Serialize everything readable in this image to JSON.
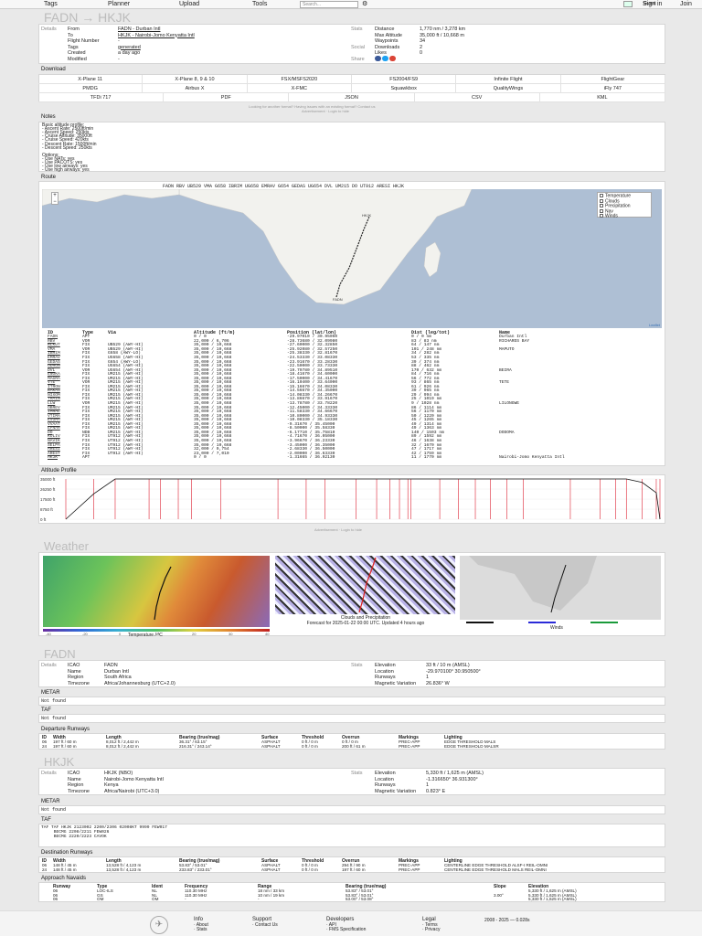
{
  "topnav": {
    "tags": "Tags",
    "planner": "Planner",
    "upload": "Upload",
    "tools": "Tools",
    "search_placeholder": "Search...",
    "guest": "Guest",
    "signin": "Sign in",
    "join": "Join"
  },
  "title": "FADN → HKJK",
  "details": {
    "section": "Details",
    "rows": [
      {
        "k": "From",
        "v": "FADN - Durban Intl"
      },
      {
        "k": "To",
        "v": "HKJK - Nairobi-Jomo Kenyatta Intl"
      },
      {
        "k": "Flight Number",
        "v": "-"
      },
      {
        "k": "Tags",
        "v": "generated"
      },
      {
        "k": "Created",
        "v": "a day ago"
      },
      {
        "k": "Modified",
        "v": "-"
      }
    ],
    "stats_label": "Stats",
    "stats": [
      {
        "k": "Distance",
        "v": "1,770 nm / 3,278 km"
      },
      {
        "k": "Max Altitude",
        "v": "35,000 ft / 10,668 m"
      },
      {
        "k": "Waypoints",
        "v": "34"
      }
    ],
    "social_label": "Social",
    "social": [
      {
        "k": "Downloads",
        "v": "2"
      },
      {
        "k": "Likes",
        "v": "0"
      }
    ],
    "share_label": "Share"
  },
  "download": {
    "section": "Download",
    "rows": [
      [
        "X-Plane 11",
        "X-Plane 8, 9 & 10",
        "FSX/MSFS2020",
        "FS2004/FS9",
        "Infinite Flight",
        "FlightGear"
      ],
      [
        "PMDG",
        "Airbus X",
        "X-FMC",
        "Squawkbox",
        "QualityWings",
        "iFly 747"
      ],
      [
        "TFDi 717",
        "PDF",
        "JSON",
        "CSV",
        "KML"
      ]
    ],
    "note": "Looking for another format? Having issues with an existing format? Contact us",
    "ads": "Advertisement · Login to hide"
  },
  "notes": {
    "section": "Notes",
    "lines": [
      "Basic altitude profile:",
      "- Ascent Rate: 2500ft/min",
      "- Ascent Speed: 250kts",
      "- Cruise Altitude: 35000ft",
      "- Cruise Speed: 420kts",
      "- Descent Rate: 1500ft/min",
      "- Descent Speed: 250kts",
      "",
      "Options:",
      "- Use NATs: yes",
      "- Use PACOTS: yes",
      "- Use low airways: yes",
      "- Use high airways: yes"
    ]
  },
  "route": {
    "section": "Route",
    "string": "FADN RBV UB529 VMA G658 IBRIM UG658 EMRAV G654 GEDAS UG654 DVL UM215 DO UT912 ARESI HKJK",
    "layers": [
      "Temperature",
      "Clouds",
      "Precipitation",
      "Nav",
      "Winds"
    ],
    "attribution": "Leaflet",
    "columns": [
      "ID",
      "Type",
      "Via",
      "Altitude (ft/m)",
      "Position (lat/lon)",
      "Dist (leg/tot)",
      "Name"
    ],
    "rows": [
      [
        "FADN",
        "APT",
        "",
        "0 / 0",
        "-29.97010 / 30.95050",
        "0 / 0 nm",
        "Durban Intl"
      ],
      [
        "RBV",
        "VOR",
        "",
        "22,000 / 6,706",
        "-28.73680 / 32.09980",
        "83 / 83 nm",
        "RICHARDS BAY"
      ],
      [
        "BLKUT",
        "FIX",
        "UB529 (AWY-HI)",
        "35,000 / 10,668",
        "-27.60000 / 32.32850",
        "64 / 147 nm",
        ""
      ],
      [
        "VMA",
        "VOR",
        "UB529 (AWY-HI)",
        "35,000 / 10,668",
        "-25.92080 / 32.57250",
        "101 / 248 nm",
        "MAPUTO"
      ],
      [
        "IBRIM",
        "FIX",
        "G658 (AWY-LO)",
        "35,000 / 10,668",
        "-25.38330 / 32.81670",
        "34 / 282 nm",
        ""
      ],
      [
        "EMRAV",
        "FIX",
        "UG658 (AWY-HI)",
        "35,000 / 10,668",
        "-24.53330 / 33.08330",
        "53 / 335 nm",
        ""
      ],
      [
        "GEDAS",
        "FIX",
        "G654 (AWY-LO)",
        "35,000 / 10,668",
        "-23.91670 / 33.28330",
        "39 / 374 nm",
        ""
      ],
      [
        "ODRUN",
        "FIX",
        "UG654 (AWY-HI)",
        "35,000 / 10,668",
        "-22.50000 / 33.73330",
        "88 / 462 nm",
        ""
      ],
      [
        "DVL",
        "VOR",
        "UG654 (AWY-HI)",
        "35,000 / 10,668",
        "-19.79780 / 34.89510",
        "170 / 632 nm",
        "BEIRA"
      ],
      [
        "ENOKA",
        "FIX",
        "UM215 (AWY-HI)",
        "35,000 / 10,668",
        "-18.41670 / 34.60000",
        "84 / 716 nm",
        ""
      ],
      [
        "MAGRA",
        "FIX",
        "UM215 (AWY-HI)",
        "35,000 / 10,668",
        "-17.50000 / 34.41670",
        "56 / 772 nm",
        ""
      ],
      [
        "VTE",
        "VOR",
        "UM215 (AWY-HI)",
        "35,000 / 10,668",
        "-16.10400 / 33.64000",
        "93 / 865 nm",
        "TETE"
      ],
      [
        "ITRON",
        "FIX",
        "UM215 (AWY-HI)",
        "35,000 / 10,668",
        "-15.16670 / 34.08330",
        "61 / 926 nm",
        ""
      ],
      [
        "BAKAS",
        "FIX",
        "UM215 (AWY-HI)",
        "35,000 / 10,668",
        "-14.56670 / 34.35000",
        "39 / 965 nm",
        ""
      ],
      [
        "NIXOM",
        "FIX",
        "UM215 (AWY-HI)",
        "35,000 / 10,668",
        "-14.08330 / 34.26670",
        "29 / 994 nm",
        ""
      ],
      [
        "THAIN",
        "FIX",
        "UM215 (AWY-HI)",
        "35,000 / 10,668",
        "-13.86670 / 33.91670",
        "25 / 1019 nm",
        ""
      ],
      [
        "LLW",
        "VOR",
        "UM215 (AWY-HI)",
        "35,000 / 10,668",
        "-13.78780 / 33.78220",
        "9 / 1028 nm",
        "LILONGWE"
      ],
      [
        "OBREV",
        "FIX",
        "UM215 (AWY-HI)",
        "35,000 / 10,668",
        "-12.45000 / 34.33330",
        "86 / 1114 nm",
        ""
      ],
      [
        "IMRAL",
        "FIX",
        "UM215 (AWY-HI)",
        "35,000 / 10,668",
        "-11.58330 / 34.66670",
        "56 / 1170 nm",
        ""
      ],
      [
        "VTIMA",
        "FIX",
        "UM215 (AWY-HI)",
        "35,000 / 10,668",
        "-10.80000 / 34.93330",
        "50 / 1220 nm",
        ""
      ],
      [
        "EVOMA",
        "FIX",
        "UM215 (AWY-HI)",
        "35,000 / 10,668",
        "-10.08330 / 35.18330",
        "45 / 1265 nm",
        ""
      ],
      [
        "VVAAT",
        "FIX",
        "UM215 (AWY-HI)",
        "35,000 / 10,668",
        "-9.31670 / 35.45000",
        "49 / 1314 nm",
        ""
      ],
      [
        "EPNAR",
        "FIX",
        "UM215 (AWY-HI)",
        "35,000 / 10,668",
        "-8.50000 / 35.58330",
        "49 / 1363 nm",
        ""
      ],
      [
        "DO",
        "NDB",
        "UM215 (AWY-HI)",
        "35,000 / 10,668",
        "-6.17710 / 35.75810",
        "140 / 1503 nm",
        "DODOMA"
      ],
      [
        "KOLIV",
        "FIX",
        "UT912 (AWY-HI)",
        "35,000 / 10,668",
        "-4.71670 / 36.05000",
        "89 / 1592 nm",
        ""
      ],
      [
        "NAVIK",
        "FIX",
        "UT912 (AWY-HI)",
        "35,000 / 10,668",
        "-3.96670 / 36.23330",
        "46 / 1638 nm",
        ""
      ],
      [
        "SELPA",
        "FIX",
        "UT912 (AWY-HI)",
        "35,000 / 10,668",
        "-3.45000 / 36.35000",
        "32 / 1670 nm",
        ""
      ],
      [
        "ARESI",
        "FIX",
        "UT912 (AWY-HI)",
        "32,000 / 9,754",
        "-2.68330 / 36.50000",
        "47 / 1717 nm",
        ""
      ],
      [
        "AREST",
        "FIX",
        "UT912 (AWY-HI)",
        "23,000 / 7,010",
        "-2.00000 / 36.63330",
        "42 / 1759 nm",
        ""
      ],
      [
        "HKJK",
        "APT",
        "",
        "0 / 0",
        "-1.31665 / 36.92130",
        "11 / 1770 nm",
        "Nairobi-Jomo Kenyatta Intl"
      ]
    ]
  },
  "altitude": {
    "section": "Altitude Profile",
    "ylabels": [
      "35000 ft",
      "26250 ft",
      "17500 ft",
      "8750 ft",
      "0 ft"
    ],
    "ads": "Advertisement · Login to hide"
  },
  "weather": {
    "title": "Weather",
    "temp_caption": "Temperature / °C",
    "temp_ticks": [
      "-40",
      "-20",
      "0",
      "10",
      "20",
      "30",
      "40"
    ],
    "cloud_caption": "Clouds and Precipitation\nForecast for 2025-01-22 00:00 UTC. Updated 4 hours ago",
    "wind_caption": "Winds"
  },
  "fadn": {
    "title": "FADN",
    "details_label": "Details",
    "rows": [
      {
        "k": "ICAO",
        "v": "FADN"
      },
      {
        "k": "Name",
        "v": "Durban Intl"
      },
      {
        "k": "Region",
        "v": "South Africa"
      },
      {
        "k": "Timezone",
        "v": "Africa/Johannesburg (UTC+2.0)"
      }
    ],
    "stats_label": "Stats",
    "stats": [
      {
        "k": "Elevation",
        "v": "33 ft / 10 m (AMSL)"
      },
      {
        "k": "Location",
        "v": "-29.970100° 30.950500°"
      },
      {
        "k": "Runways",
        "v": "1"
      },
      {
        "k": "Magnetic Variation",
        "v": "26.836° W"
      }
    ],
    "metar_label": "METAR",
    "metar": "Not found",
    "taf_label": "TAF",
    "taf": "Not found",
    "runways_label": "Departure Runways",
    "rw_cols": [
      "ID",
      "Width",
      "Length",
      "Bearing (true/mag)",
      "Surface",
      "Threshold",
      "Overrun",
      "Markings",
      "Lighting"
    ],
    "rw_rows": [
      [
        "06",
        "197 ft / 60 m",
        "8,012 ft / 2,442 m",
        "36.31° / 63.15°",
        "ASPHALT",
        "0 ft / 0 m",
        "0 ft / 0 m",
        "PREC-APP",
        "EDGE THRESHOLD MALS"
      ],
      [
        "24",
        "197 ft / 60 m",
        "8,012 ft / 2,442 m",
        "216.31° / 243.14°",
        "ASPHALT",
        "0 ft / 0 m",
        "200 ft / 61 m",
        "PREC-APP",
        "EDGE THRESHOLD MALSR"
      ]
    ]
  },
  "hkjk": {
    "title": "HKJK",
    "details_label": "Details",
    "rows": [
      {
        "k": "ICAO",
        "v": "HKJK (NBO)"
      },
      {
        "k": "Name",
        "v": "Nairobi-Jomo Kenyatta Intl"
      },
      {
        "k": "Region",
        "v": "Kenya"
      },
      {
        "k": "Timezone",
        "v": "Africa/Nairobi (UTC+3.0)"
      }
    ],
    "stats_label": "Stats",
    "stats": [
      {
        "k": "Elevation",
        "v": "5,330 ft / 1,625 m (AMSL)"
      },
      {
        "k": "Location",
        "v": "-1.316650° 36.931300°"
      },
      {
        "k": "Runways",
        "v": "1"
      },
      {
        "k": "Magnetic Variation",
        "v": "0.823° E"
      }
    ],
    "metar_label": "METAR",
    "metar": "Not found",
    "taf_label": "TAF",
    "taf_lines": [
      "TAF TAF HKJK 2123002 2200/2306 02008KT 9999 FEW017",
      "     BECMG 2208/2211 FEW026",
      "     BECMG 2220/2223 CAVOK"
    ],
    "runways_label": "Destination Runways",
    "rw_cols": [
      "ID",
      "Width",
      "Length",
      "Bearing (true/mag)",
      "Surface",
      "Threshold",
      "Overrun",
      "Markings",
      "Lighting"
    ],
    "rw_rows": [
      [
        "06",
        "148 ft / 45 m",
        "13,528 ft / 4,123 m",
        "53.83° / 53.01°",
        "ASPHALT",
        "0 ft / 0 m",
        "294 ft / 90 m",
        "PREC-APP",
        "CENTERLINE EDGE THRESHOLD ALSF-I REIL-OMNI"
      ],
      [
        "24",
        "148 ft / 45 m",
        "13,528 ft / 4,123 m",
        "233.83° / 233.01°",
        "ASPHALT",
        "0 ft / 0 m",
        "197 ft / 60 m",
        "PREC-APP",
        "CENTERLINE EDGE THRESHOLD MALS REIL-OMNI"
      ]
    ],
    "navaids_label": "Approach Navaids",
    "nv_cols": [
      "Runway",
      "Type",
      "Ident",
      "Frequency",
      "Range",
      "Bearing (true/mag)",
      "Slope",
      "Elevation"
    ],
    "nv_rows": [
      [
        "06",
        "LOC-ILS",
        "NL",
        "110.30 MHz",
        "18 nm / 33 km",
        "53.83° / 53.01°",
        "",
        "5,330 ft / 1,625 m (AMSL)"
      ],
      [
        "06",
        "GS",
        "NL",
        "110.30 MHz",
        "10 nm / 19 km",
        "53.83° / 53.01°",
        "3.00°",
        "5,330 ft / 1,625 m (AMSL)"
      ],
      [
        "06",
        "OM",
        "OM",
        "-",
        "-",
        "53.00° / 53.08°",
        "",
        "5,330 ft / 1,625 m (AMSL)"
      ]
    ]
  },
  "footer": {
    "info": {
      "title": "Info",
      "links": [
        "· About",
        "· Stats"
      ]
    },
    "support": {
      "title": "Support",
      "links": [
        "· Contact Us"
      ]
    },
    "developers": {
      "title": "Developers",
      "links": [
        "· API",
        "· FMS Specification"
      ]
    },
    "legal": {
      "title": "Legal",
      "links": [
        "· Terms",
        "· Privacy"
      ]
    },
    "copyright": "2008 - 2025 — 0.028s"
  }
}
